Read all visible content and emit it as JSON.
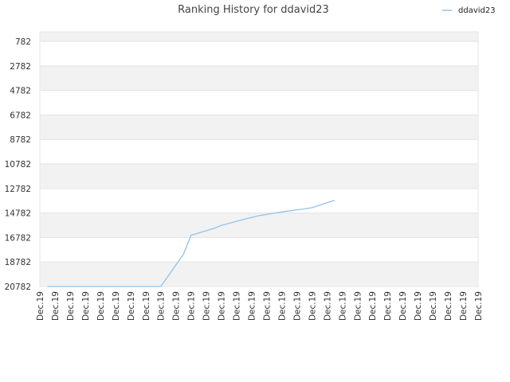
{
  "chart_data": {
    "type": "line",
    "title": "Ranking History for ddavid23",
    "xlabel": "",
    "ylabel": "",
    "y_inverted": true,
    "ylim": [
      20782,
      0
    ],
    "yticks": [
      782,
      2782,
      4782,
      6782,
      8782,
      10782,
      12782,
      14782,
      16782,
      18782,
      20782
    ],
    "ytick_labels": [
      "782",
      "2782",
      "4782",
      "6782",
      "8782",
      "10782",
      "12782",
      "14782",
      "16782",
      "18782",
      "20782"
    ],
    "xtick_labels": [
      "Dec.19",
      "Dec.19",
      "Dec.19",
      "Dec.19",
      "Dec.19",
      "Dec.19",
      "Dec.19",
      "Dec.19",
      "Dec.19",
      "Dec.19",
      "Dec.19",
      "Dec.19",
      "Dec.19",
      "Dec.19",
      "Dec.19",
      "Dec.19",
      "Dec.19",
      "Dec.19",
      "Dec.19",
      "Dec.19",
      "Dec.19",
      "Dec.19",
      "Dec.19",
      "Dec.19",
      "Dec.19",
      "Dec.19",
      "Dec.19",
      "Dec.19",
      "Dec.19",
      "Dec.19"
    ],
    "legend_position": "top-right",
    "grid": true,
    "series": [
      {
        "name": "ddavid23",
        "color": "#90c2ec",
        "x": [
          1,
          16,
          19,
          20,
          23,
          24,
          27,
          29,
          30,
          31,
          32,
          35,
          36,
          37,
          38,
          39
        ],
        "values": [
          20782,
          20782,
          18150,
          16600,
          16050,
          15800,
          15300,
          15000,
          14900,
          14800,
          14700,
          14450,
          14350,
          14150,
          13950,
          13750
        ]
      }
    ]
  }
}
